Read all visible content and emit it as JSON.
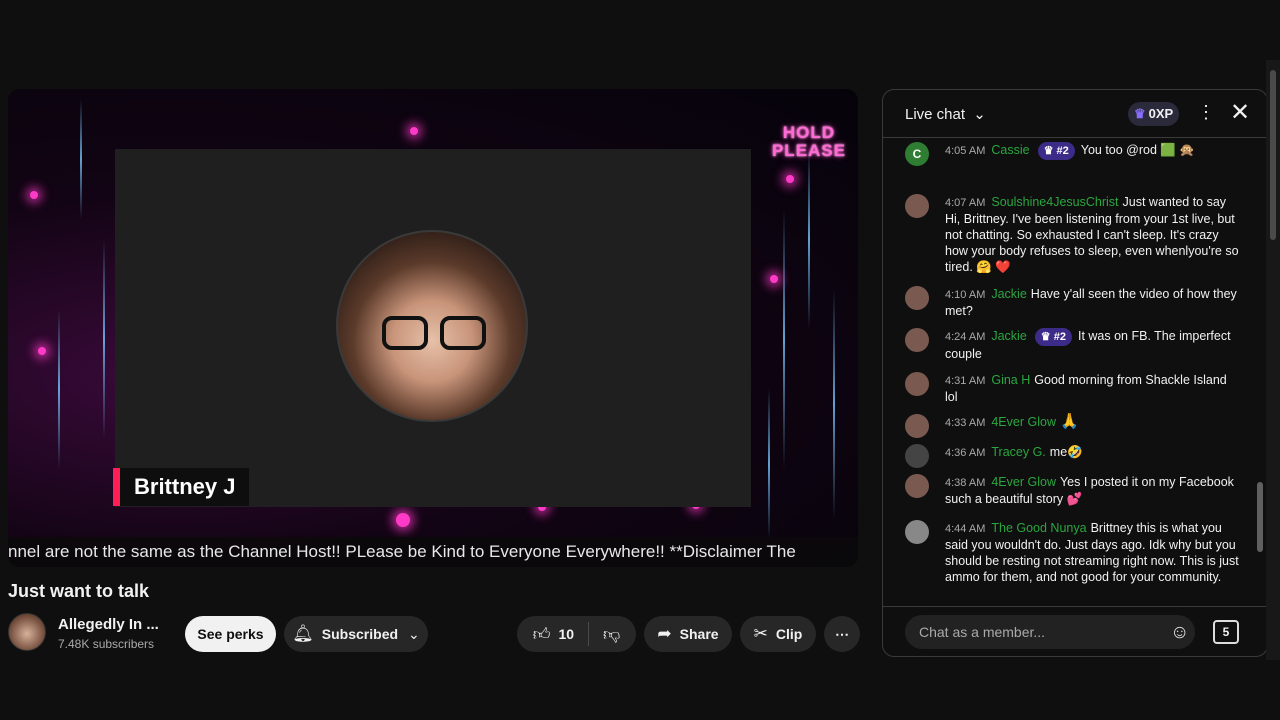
{
  "video": {
    "hold_line1": "HOLD",
    "hold_line2": "PLEASE",
    "presenter_name": "Brittney J",
    "ticker": "nnel are not the same as the Channel Host!! PLease be Kind to Everyone Everywhere!! **Disclaimer The"
  },
  "title": "Just want to talk",
  "channel": {
    "name": "Allegedly In ...",
    "subscribers": "7.48K subscribers"
  },
  "actions": {
    "see_perks": "See perks",
    "subscribed": "Subscribed",
    "likes": "10",
    "share": "Share",
    "clip": "Clip"
  },
  "chat": {
    "title": "Live chat",
    "xp": "0XP",
    "input_placeholder": "Chat as a member...",
    "messages": [
      {
        "time": "4:05 AM",
        "author": "Cassie",
        "badge": "#2",
        "text": "You too @rod 🟩 🙊"
      },
      {
        "time": "4:07 AM",
        "author": "Soulshine4JesusChrist",
        "badge": "",
        "text": "Just wanted to say Hi, Brittney. I've been listening from your 1st live, but not chatting. So exhausted I can't sleep. It's crazy how your body refuses to sleep, even whenlyou're so tired. 🤗 ❤️"
      },
      {
        "time": "4:10 AM",
        "author": "Jackie",
        "badge": "",
        "text": "Have y'all seen the video of how they met?"
      },
      {
        "time": "4:24 AM",
        "author": "Jackie",
        "badge": "#2",
        "text": "It was on FB. The imperfect couple"
      },
      {
        "time": "4:31 AM",
        "author": "Gina H",
        "badge": "",
        "text": "Good morning from Shackle Island lol"
      },
      {
        "time": "4:33 AM",
        "author": "4Ever Glow",
        "badge": "",
        "text": "🙏"
      },
      {
        "time": "4:36 AM",
        "author": "Tracey G.",
        "badge": "",
        "text": "me🤣"
      },
      {
        "time": "4:38 AM",
        "author": "4Ever Glow",
        "badge": "",
        "text": "Yes I posted it on my Facebook such a beautiful story 💕"
      },
      {
        "time": "4:44 AM",
        "author": "The Good Nunya",
        "badge": "",
        "text": "Brittney this is what you said you wouldn't do. Just days ago. Idk why but you should be resting not streaming right now. This is just ammo for them, and not good for your community."
      }
    ]
  },
  "icons": [
    "like-icon",
    "dislike-icon",
    "share-icon",
    "scissors-icon",
    "bell-icon",
    "more-icon",
    "close-icon",
    "smiley-icon",
    "superchat-icon"
  ]
}
